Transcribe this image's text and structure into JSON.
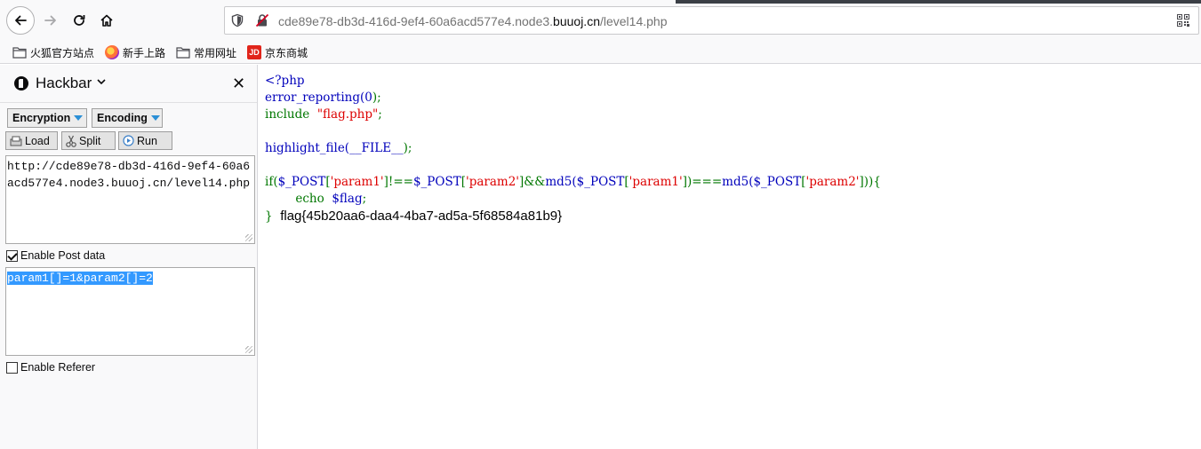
{
  "browser": {
    "url_prefix": "cde89e78-db3d-416d-9ef4-60a6acd577e4.node3.",
    "url_domain": "buuoj.cn",
    "url_path": "/level14.php",
    "icons": [
      "back-icon",
      "forward-icon",
      "reload-icon",
      "home-icon",
      "shield-icon",
      "insecure-lock-icon",
      "qr-code-icon"
    ]
  },
  "bookmarks": [
    {
      "label": "火狐官方站点",
      "icon": "folder-icon"
    },
    {
      "label": "新手上路",
      "icon": "firefox-icon"
    },
    {
      "label": "常用网址",
      "icon": "folder-icon"
    },
    {
      "label": "京东商城",
      "icon": "jd-icon",
      "icon_text": "JD"
    }
  ],
  "hackbar": {
    "title": "Hackbar",
    "encryption_label": "Encryption",
    "encoding_label": "Encoding",
    "load_label": "Load",
    "split_label": "Split",
    "run_label": "Run",
    "url_value": "http://cde89e78-db3d-416d-9ef4-60a6acd577e4.node3.buuoj.cn/level14.php",
    "enable_post_label": "Enable Post data",
    "enable_post_checked": true,
    "post_value": "param1[]=1&param2[]=2",
    "enable_referer_label": "Enable Referer",
    "enable_referer_checked": false
  },
  "page": {
    "code": {
      "open_tag": "<?php",
      "line1_fn": "error_reporting(",
      "line1_arg": "0",
      "line1_end": ");",
      "line2_kw": "include",
      "line2_str": "\"flag.php\"",
      "line2_end": ";",
      "line3_fn": "highlight_file(",
      "line3_const": "__FILE__",
      "line3_end": ");",
      "if_kw": "if(",
      "if_var1": "$_POST",
      "if_key1": "'param1'",
      "if_op1": "]!==",
      "if_var2": "$_POST",
      "if_key2": "'param2'",
      "if_op2": "]&&",
      "if_fn1": "md5(",
      "if_var3": "$_POST",
      "if_key3": "'param1'",
      "if_op3": "])===",
      "if_fn2": "md5(",
      "if_var4": "$_POST",
      "if_key4": "'param2'",
      "if_close": "])){",
      "echo_kw": "echo",
      "echo_var": "$flag",
      "echo_end": ";",
      "close_brace": "}"
    },
    "flag": "flag{45b20aa6-daa4-4ba7-ad5a-5f68584a81b9}"
  }
}
